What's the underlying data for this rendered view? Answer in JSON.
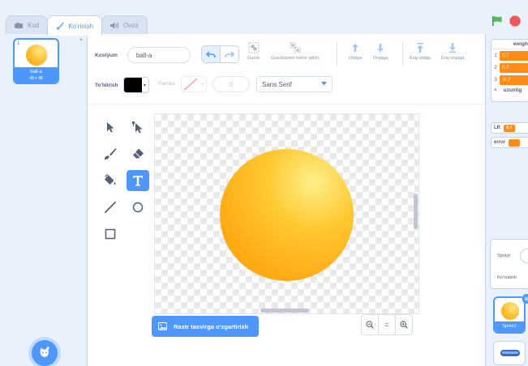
{
  "tabs": [
    {
      "label": "Kod"
    },
    {
      "label": "Koʻrinish"
    },
    {
      "label": "Ovoz"
    }
  ],
  "costume": {
    "number": "1",
    "name": "ball-a",
    "size": "48 x 48"
  },
  "toolbar": {
    "costume_label": "Kostyum",
    "costume_name": "ball-a",
    "group": "Guruh",
    "ungroup": "Guruhlashni bekor qilish",
    "forward": "Oldiga",
    "backward": "Orqaga",
    "front": "Eng oldiga",
    "back": "Eng orqaga"
  },
  "style": {
    "fill_label": "To'ldirish",
    "outline_label": "Ramka",
    "outline_width": "0",
    "font": "Sans Serif"
  },
  "canvas": {
    "convert_button": "Rastr tasvirga o'zgartirish"
  },
  "zoom": {
    "out": "−",
    "reset": "=",
    "in": "+"
  },
  "stage": {
    "list_monitor": {
      "title": "weigh",
      "rows": [
        {
          "index": "1",
          "value": "0.7"
        },
        {
          "index": "2",
          "value": "0.7"
        },
        {
          "index": "3",
          "value": "-0.7"
        }
      ],
      "footer_plus": "+",
      "footer": "uzunlig"
    },
    "var_lr": {
      "name": "LR",
      "value": "0.7"
    },
    "var_error": {
      "name": "error",
      "value": ""
    },
    "sprite_label": "Sprayt",
    "show_label": "Ko'rsatish",
    "sprite_name": "Sprite1"
  },
  "colors": {
    "accent": "#4d97ff",
    "ball_light": "#ffef8a",
    "ball_dark": "#ff9d00",
    "variable": "#ff8c1a",
    "green_flag": "#4cbf56",
    "stop": "#ec5959"
  }
}
